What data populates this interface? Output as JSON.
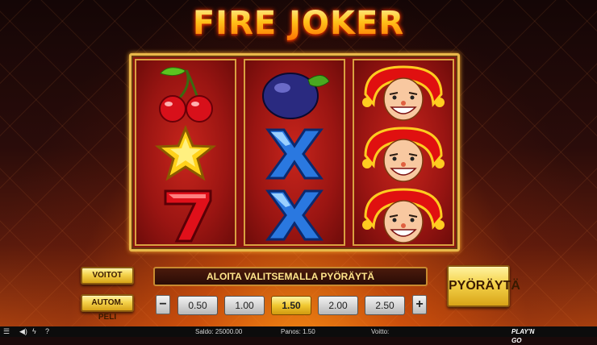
{
  "game": {
    "title": "FIRE JOKER"
  },
  "reels": [
    [
      "cherry-icon",
      "star-icon",
      "seven-icon"
    ],
    [
      "plum-icon",
      "x-icon",
      "x-icon"
    ],
    [
      "joker-icon",
      "joker-icon",
      "joker-icon"
    ]
  ],
  "controls": {
    "wins_label": "VOITOT",
    "autoplay_label": "AUTOM. PELI",
    "message": "ALOITA VALITSEMALLA PYÖRÄYTÄ",
    "spin_label": "PYÖRÄYTÄ",
    "bet_minus": "−",
    "bet_plus": "+",
    "bet_options": [
      "0.50",
      "1.00",
      "1.50",
      "2.00",
      "2.50"
    ],
    "selected_bet": "1.50"
  },
  "statusbar": {
    "balance_label": "Saldo: 25000.00",
    "bet_label": "Panos: 1.50",
    "win_label": "Voitto:",
    "menu_icon": "menu-icon",
    "sound_icon": "sound-icon",
    "turbo_icon": "turbo-icon",
    "help_icon": "help-icon",
    "logo": "PLAY'N GO"
  },
  "colors": {
    "gold": "#f4d24a",
    "reel_red": "#9a1512",
    "frame_gold": "#e8b84a"
  }
}
